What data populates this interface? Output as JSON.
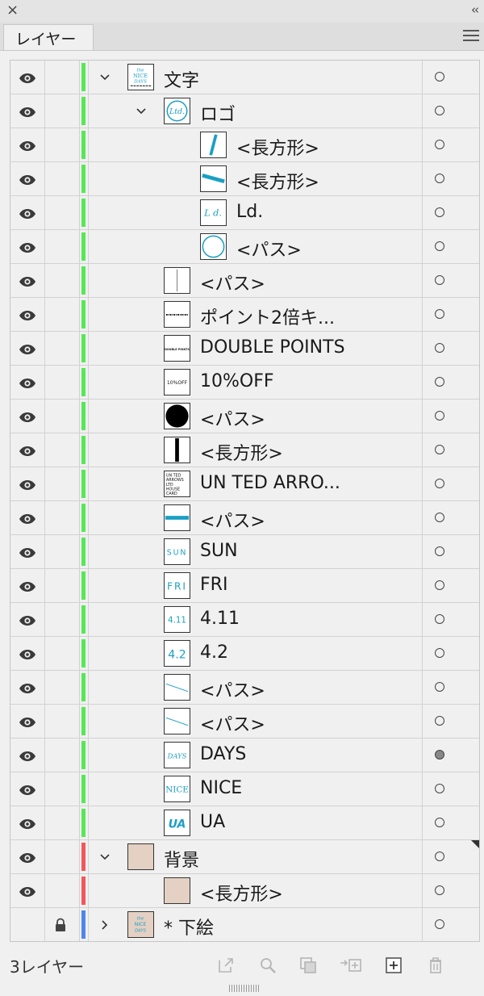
{
  "panel": {
    "close_glyph": "×",
    "collapse_glyph": "‹‹",
    "tab_label": "レイヤー",
    "footer_count": "3レイヤー"
  },
  "colors": {
    "green": "#55e856",
    "red": "#f3565a",
    "blue": "#4e86ee",
    "teal": "#1a9fc4",
    "beige": "#e4d1c4"
  },
  "rows": [
    {
      "label": "文字",
      "indent": 0,
      "chevron": "down",
      "color": "green",
      "thumb": "text-artwork"
    },
    {
      "label": "ロゴ",
      "indent": 1,
      "chevron": "down",
      "color": "green",
      "thumb": "logo-ltd"
    },
    {
      "label": "<長方形>",
      "indent": 2,
      "chevron": "",
      "color": "green",
      "thumb": "diagonal-rect"
    },
    {
      "label": "<長方形>",
      "indent": 2,
      "chevron": "",
      "color": "green",
      "thumb": "horizontal-rect"
    },
    {
      "label": "Ld.",
      "indent": 2,
      "chevron": "",
      "color": "green",
      "thumb": "ld-text"
    },
    {
      "label": "<パス>",
      "indent": 2,
      "chevron": "",
      "color": "green",
      "thumb": "circle-outline"
    },
    {
      "label": "<パス>",
      "indent": 1,
      "chevron": "",
      "color": "green",
      "thumb": "vertical-line"
    },
    {
      "label": "ポイント2倍キ...",
      "indent": 1,
      "chevron": "",
      "color": "green",
      "thumb": "dashed-text"
    },
    {
      "label": "DOUBLE POINTS",
      "indent": 1,
      "chevron": "",
      "color": "green",
      "thumb": "double-points-text"
    },
    {
      "label": "10%OFF",
      "indent": 1,
      "chevron": "",
      "color": "green",
      "thumb": "ten-off-text"
    },
    {
      "label": "<パス>",
      "indent": 1,
      "chevron": "",
      "color": "green",
      "thumb": "black-circle"
    },
    {
      "label": "<長方形>",
      "indent": 1,
      "chevron": "",
      "color": "green",
      "thumb": "black-bar"
    },
    {
      "label": "UN TED ARRO...",
      "indent": 1,
      "chevron": "",
      "color": "green",
      "thumb": "card-text"
    },
    {
      "label": "<パス>",
      "indent": 1,
      "chevron": "",
      "color": "green",
      "thumb": "teal-bar"
    },
    {
      "label": "SUN",
      "indent": 1,
      "chevron": "",
      "color": "green",
      "thumb": "sun-text"
    },
    {
      "label": "FRI",
      "indent": 1,
      "chevron": "",
      "color": "green",
      "thumb": "fri-text"
    },
    {
      "label": "4.11",
      "indent": 1,
      "chevron": "",
      "color": "green",
      "thumb": "date-411"
    },
    {
      "label": "4.2",
      "indent": 1,
      "chevron": "",
      "color": "green",
      "thumb": "date-42"
    },
    {
      "label": "<パス>",
      "indent": 1,
      "chevron": "",
      "color": "green",
      "thumb": "slant-line"
    },
    {
      "label": "<パス>",
      "indent": 1,
      "chevron": "",
      "color": "green",
      "thumb": "slant-line"
    },
    {
      "label": "DAYS",
      "indent": 1,
      "chevron": "",
      "color": "green",
      "thumb": "days-text",
      "target_filled": true
    },
    {
      "label": "NICE",
      "indent": 1,
      "chevron": "",
      "color": "green",
      "thumb": "nice-text"
    },
    {
      "label": "UA",
      "indent": 1,
      "chevron": "",
      "color": "green",
      "thumb": "ua-text"
    },
    {
      "label": "背景",
      "indent": 0,
      "chevron": "down",
      "color": "red",
      "thumb": "beige",
      "corner": true
    },
    {
      "label": "<長方形>",
      "indent": 1,
      "chevron": "",
      "color": "red",
      "thumb": "beige"
    },
    {
      "label": "* 下絵",
      "indent": 0,
      "chevron": "right",
      "color": "blue",
      "thumb": "sketch",
      "locked": true,
      "hidden": true
    }
  ],
  "thumb_text": {
    "logo-ltd": "Ltd.",
    "ld-text": "L d.",
    "double-points-text": "DOUBLE POINTS",
    "ten-off-text": "10%OFF",
    "card-text": [
      "UN TED",
      "ARROWS",
      "LTD",
      "HOUSE",
      "CARD"
    ],
    "sun-text": "SUN",
    "fri-text": "FRI",
    "date-411": "4.11",
    "date-42": "4.2",
    "days-text": "DAYS",
    "nice-text": "NICE",
    "ua-text": "UA",
    "text-artwork": [
      "the",
      "NICE",
      "DAYS"
    ],
    "sketch": [
      "the",
      "NICE",
      "DAYS"
    ]
  },
  "footer_icons": [
    "export-icon",
    "search-icon",
    "clipping-mask-icon",
    "move-to-layer-icon",
    "new-layer-icon",
    "trash-icon"
  ]
}
